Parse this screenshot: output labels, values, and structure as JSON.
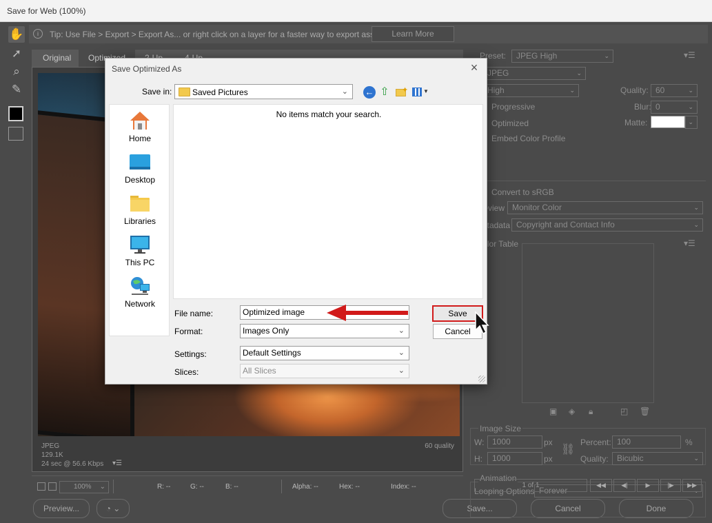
{
  "window": {
    "title": "Save for Web (100%)"
  },
  "tip": {
    "icon": "info-icon",
    "text": "Tip: Use File > Export > Export As...  or right click on a layer for a faster way to export assets",
    "learn_more": "Learn More"
  },
  "tabs": [
    {
      "label": "Original"
    },
    {
      "label": "Optimized"
    },
    {
      "label": "2-Up"
    },
    {
      "label": "4-Up"
    }
  ],
  "preview_info": {
    "format": "JPEG",
    "size": "129.1K",
    "time": "24 sec @ 56.6 Kbps",
    "quality": "60 quality"
  },
  "statusbar": {
    "zoom": "100%",
    "r": "R: --",
    "g": "G: --",
    "b": "B: --",
    "alpha": "Alpha: --",
    "hex": "Hex: --",
    "index": "Index: --"
  },
  "bottom_buttons": {
    "preview": "Preview...",
    "save": "Save...",
    "cancel": "Cancel",
    "done": "Done"
  },
  "right_panel": {
    "preset_label": "Preset:",
    "preset_value": "JPEG High",
    "format_value": "JPEG",
    "quality_level": "High",
    "quality_label": "Quality:",
    "quality_value": "60",
    "progressive": "Progressive",
    "blur_label": "Blur:",
    "blur_value": "0",
    "optimized": "Optimized",
    "matte_label": "Matte:",
    "embed_profile": "Embed Color Profile",
    "convert_srgb": "Convert to sRGB",
    "preview_label": "Preview:",
    "preview_value": "Monitor Color",
    "metadata_label": "Metadata:",
    "metadata_value": "Copyright and Contact Info",
    "color_table": "Color Table",
    "image_size": "Image Size",
    "w_label": "W:",
    "w_value": "1000",
    "h_label": "H:",
    "h_value": "1000",
    "px": "px",
    "percent_label": "Percent:",
    "percent_value": "100",
    "percent_unit": "%",
    "quality2_label": "Quality:",
    "quality2_value": "Bicubic",
    "animation": "Animation",
    "looping_label": "Looping Options:",
    "looping_value": "Forever",
    "frame_counter": "1 of 1"
  },
  "dialog": {
    "title": "Save Optimized As",
    "save_in_label": "Save in:",
    "save_in_value": "Saved Pictures",
    "empty_message": "No items match your search.",
    "places": [
      {
        "label": "Home"
      },
      {
        "label": "Desktop"
      },
      {
        "label": "Libraries"
      },
      {
        "label": "This PC"
      },
      {
        "label": "Network"
      }
    ],
    "file_name_label": "File name:",
    "file_name_value": "Optimized image",
    "format_label": "Format:",
    "format_value": "Images Only",
    "settings_label": "Settings:",
    "settings_value": "Default Settings",
    "slices_label": "Slices:",
    "slices_value": "All Slices",
    "save_button": "Save",
    "cancel_button": "Cancel"
  },
  "colors": {
    "highlight_red": "#d11a1a",
    "folder_yellow": "#f2c94c",
    "accent_blue": "#2f74d0"
  }
}
